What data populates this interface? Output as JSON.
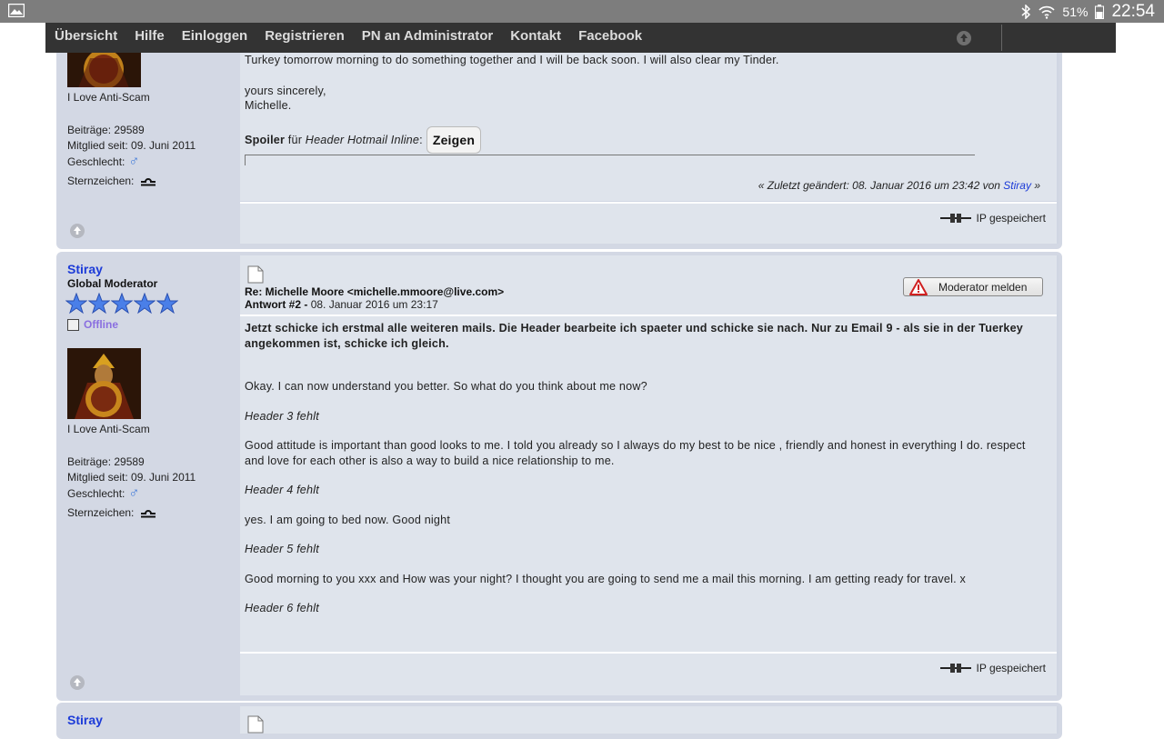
{
  "statusbar": {
    "battery": "51%",
    "time": "22:54"
  },
  "nav": {
    "items": [
      "Übersicht",
      "Hilfe",
      "Einloggen",
      "Registrieren",
      "PN an Administrator",
      "Kontakt",
      "Facebook"
    ]
  },
  "post1": {
    "poster": {
      "signature_line": "I Love Anti-Scam",
      "posts": "Beiträge: 29589",
      "member_since": "Mitglied seit: 09. Juni 2011",
      "gender_label": "Geschlecht:",
      "gender_symbol": "♂",
      "zodiac_label": "Sternzeichen:"
    },
    "body_lines": [
      "Turkey tomorrow morning to do something together and I will be back soon. I will also clear my Tinder.",
      "yours sincerely,",
      "Michelle."
    ],
    "spoiler": {
      "label": "Spoiler",
      "for": "für",
      "title": "Header Hotmail Inline",
      "button": "Zeigen"
    },
    "edited": {
      "prefix": "« Zuletzt geändert: 08. Januar 2016 um 23:42 von",
      "by": "Stiray",
      "suffix": "»"
    },
    "ip_saved": "IP gespeichert"
  },
  "post2": {
    "poster": {
      "name": "Stiray",
      "role": "Global Moderator",
      "status": "Offline",
      "signature_line": "I Love Anti-Scam",
      "posts": "Beiträge: 29589",
      "member_since": "Mitglied seit: 09. Juni 2011",
      "gender_label": "Geschlecht:",
      "gender_symbol": "♂",
      "zodiac_label": "Sternzeichen:"
    },
    "subject": "Re: Michelle Moore <michelle.mmoore@live.com>",
    "reply_label": "Antwort #2 -",
    "reply_date": "08. Januar 2016 um 23:17",
    "report_button": "Moderator melden",
    "intro": "Jetzt schicke ich erstmal alle weiteren mails. Die Header bearbeite ich spaeter und schicke sie nach. Nur zu Email 9 - als sie in der Tuerkey angekommen ist, schicke ich gleich.",
    "lines": [
      "Okay. I can now understand you better. So what do you think about me now?",
      "Header 3 fehlt",
      "Good attitude is important than good looks to me. I told you already so I always do my best to be nice , friendly and honest in everything I do. respect and love for each other is also a way to build a nice relationship to me.",
      "Header 4 fehlt",
      "yes. I am going to bed now. Good night",
      "Header 5 fehlt",
      "Good morning to you xxx and How was  your night? I thought you are going to send me a mail this morning. I am getting ready for travel. x",
      "Header 6 fehlt"
    ],
    "ip_saved": "IP gespeichert"
  },
  "post3": {
    "poster": {
      "name": "Stiray"
    }
  }
}
